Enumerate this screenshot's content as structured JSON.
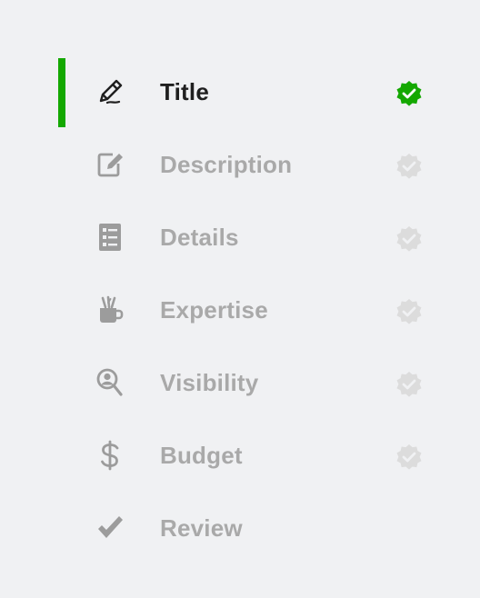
{
  "steps": [
    {
      "label": "Title",
      "icon": "pencil-icon",
      "state": "complete",
      "active": true
    },
    {
      "label": "Description",
      "icon": "edit-document-icon",
      "state": "pending",
      "active": false
    },
    {
      "label": "Details",
      "icon": "checklist-icon",
      "state": "pending",
      "active": false
    },
    {
      "label": "Expertise",
      "icon": "tools-mug-icon",
      "state": "pending",
      "active": false
    },
    {
      "label": "Visibility",
      "icon": "user-search-icon",
      "state": "pending",
      "active": false
    },
    {
      "label": "Budget",
      "icon": "dollar-icon",
      "state": "pending",
      "active": false
    },
    {
      "label": "Review",
      "icon": "checkmark-icon",
      "state": "none",
      "active": false
    }
  ],
  "colors": {
    "accent": "#14a800",
    "active_text": "#1f1f1f",
    "inactive_text": "#a9a9a9",
    "inactive_icon": "#9c9c9c",
    "badge_pending": "#dcdcdc",
    "background": "#f0f1f3"
  }
}
